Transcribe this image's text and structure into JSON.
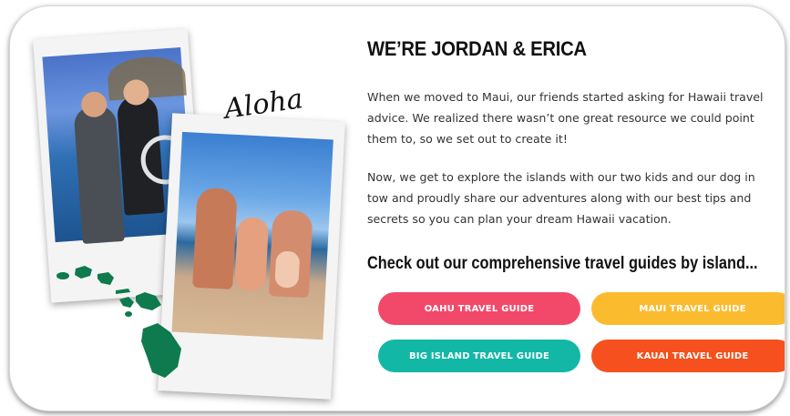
{
  "collage": {
    "script_text": "Aloha"
  },
  "intro": {
    "title": "WE’RE JORDAN & ERICA",
    "paragraph1": "When we moved to Maui, our friends started asking for Hawaii travel advice. We realized there wasn’t one great resource we could point them to, so we set out to create it!",
    "paragraph2": "Now, we get to explore the islands with our two kids and our dog in tow and proudly share our adventures along with our best tips and secrets so you can plan your dream Hawaii vacation.",
    "guides_heading": "Check out our comprehensive travel guides by island..."
  },
  "guides": [
    {
      "label": "OAHU TRAVEL GUIDE",
      "color": "#f2496b"
    },
    {
      "label": "MAUI TRAVEL GUIDE",
      "color": "#fbbb2e"
    },
    {
      "label": "BIG ISLAND TRAVEL GUIDE",
      "color": "#13b7a6"
    },
    {
      "label": "KAUAI TRAVEL GUIDE",
      "color": "#f5501d"
    }
  ],
  "colors": {
    "island_green": "#0e7a4d"
  }
}
